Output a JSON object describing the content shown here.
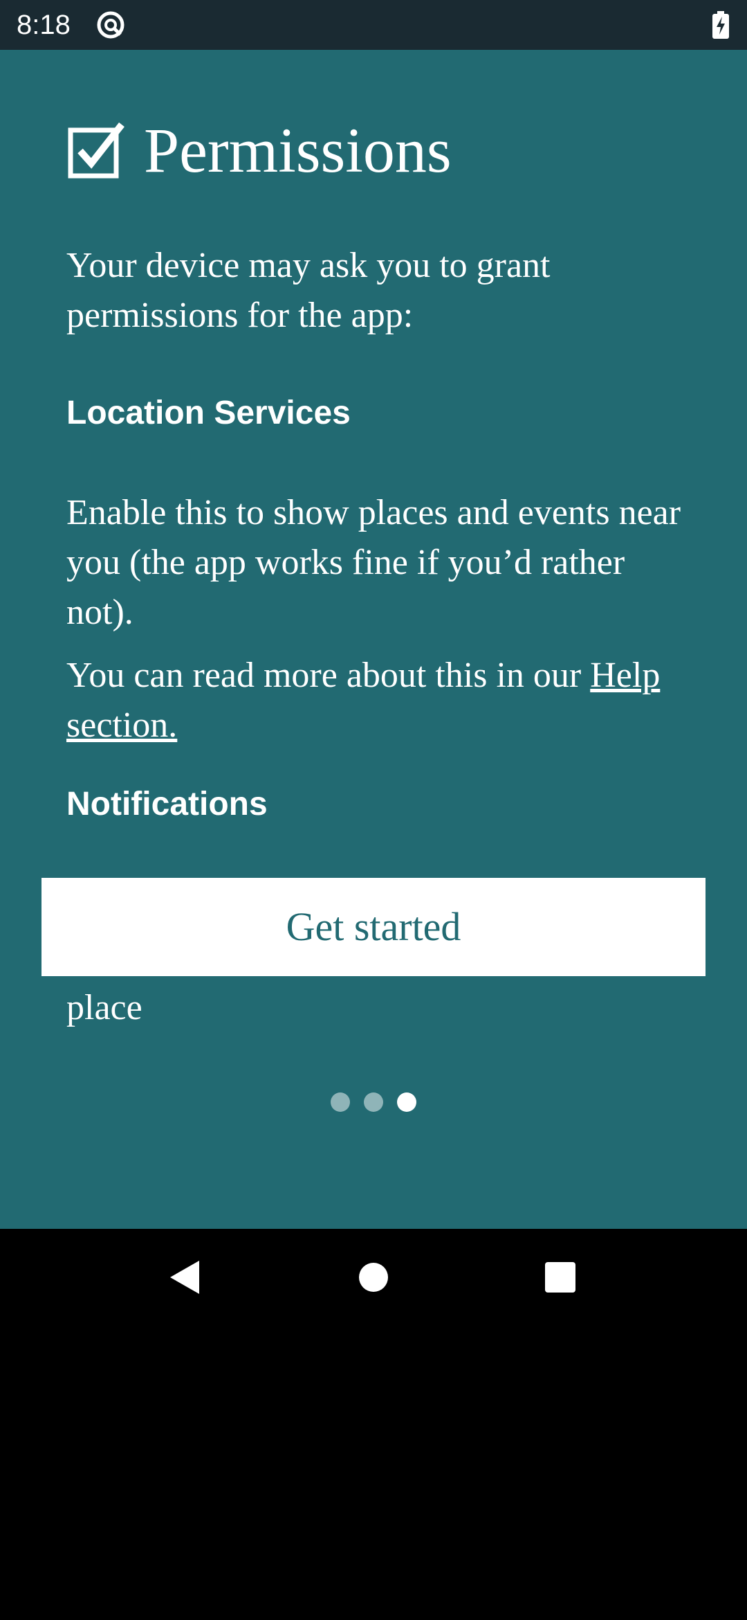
{
  "status_bar": {
    "time": "8:18",
    "app_icon": "at-sign-icon",
    "battery_icon": "battery-charging-icon"
  },
  "page": {
    "title": "Permissions",
    "title_icon": "checkbox-checked-icon",
    "intro": "Your device may ask you to grant permissions for the app:",
    "location_heading": "Location Services",
    "location_body": "Enable this to show places and events near you (the app works fine if you’d rather not).",
    "more_text": "You can read more about this in our ",
    "help_link": "Help section.",
    "notifications_heading": "Notifications",
    "partial_text": "place",
    "get_started_label": "Get started",
    "pager": {
      "total": 3,
      "current": 3
    }
  },
  "nav_bar": {
    "back": "back-icon",
    "home": "home-icon",
    "recents": "recents-icon"
  },
  "colors": {
    "background": "#226a72",
    "status_bar": "#1a2a32",
    "button_bg": "#ffffff",
    "button_text": "#226a72",
    "dot_inactive": "#8fb4b8",
    "dot_active": "#ffffff"
  }
}
